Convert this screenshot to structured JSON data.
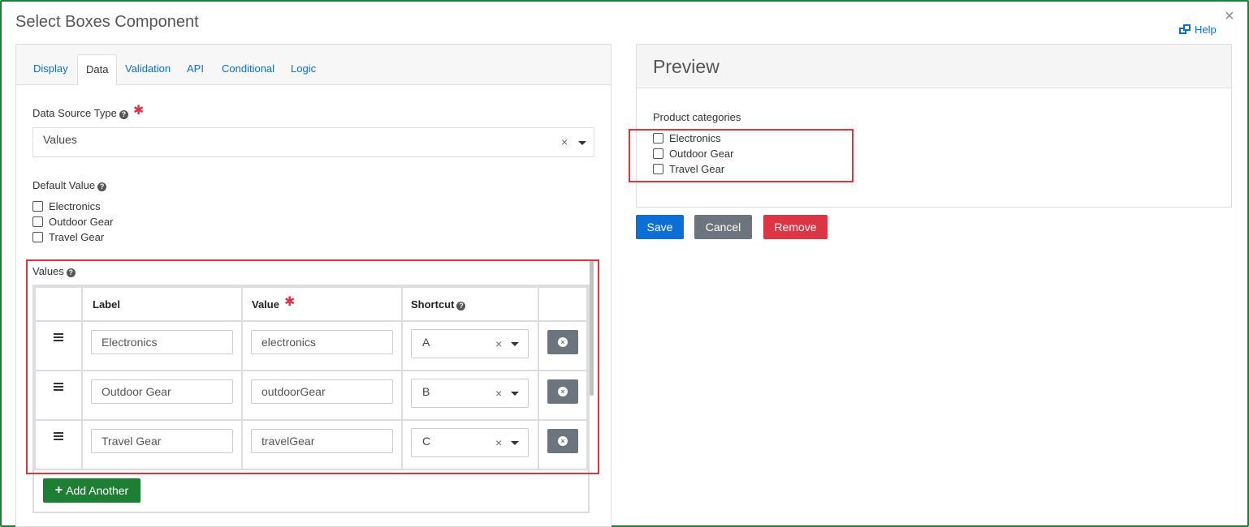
{
  "dialog": {
    "title": "Select Boxes Component",
    "close_glyph": "×",
    "help_label": "Help"
  },
  "tabs": [
    {
      "label": "Display"
    },
    {
      "label": "Data"
    },
    {
      "label": "Validation"
    },
    {
      "label": "API"
    },
    {
      "label": "Conditional"
    },
    {
      "label": "Logic"
    }
  ],
  "active_tab": "Data",
  "data_source": {
    "label": "Data Source Type",
    "value": "Values",
    "clear_glyph": "×"
  },
  "default_value": {
    "label": "Default Value",
    "options": [
      "Electronics",
      "Outdoor Gear",
      "Travel Gear"
    ]
  },
  "values_table": {
    "label": "Values",
    "headers": {
      "label": "Label",
      "value": "Value",
      "shortcut": "Shortcut"
    },
    "rows": [
      {
        "label": "Electronics",
        "value": "electronics",
        "shortcut": "A"
      },
      {
        "label": "Outdoor Gear",
        "value": "outdoorGear",
        "shortcut": "B"
      },
      {
        "label": "Travel Gear",
        "value": "travelGear",
        "shortcut": "C"
      }
    ],
    "clear_glyph": "×",
    "add_label": "Add Another",
    "add_glyph": "+"
  },
  "preview": {
    "title": "Preview",
    "field_label": "Product categories",
    "options": [
      "Electronics",
      "Outdoor Gear",
      "Travel Gear"
    ]
  },
  "actions": {
    "save": "Save",
    "cancel": "Cancel",
    "remove": "Remove"
  },
  "glyphs": {
    "required_star": "✱",
    "help_q": "?",
    "remove_x": "×"
  },
  "colors": {
    "primary": "#0b6fd6",
    "success": "#1e7e34",
    "secondary": "#6c757d",
    "danger": "#dc3545",
    "highlight": "#e0343f"
  }
}
